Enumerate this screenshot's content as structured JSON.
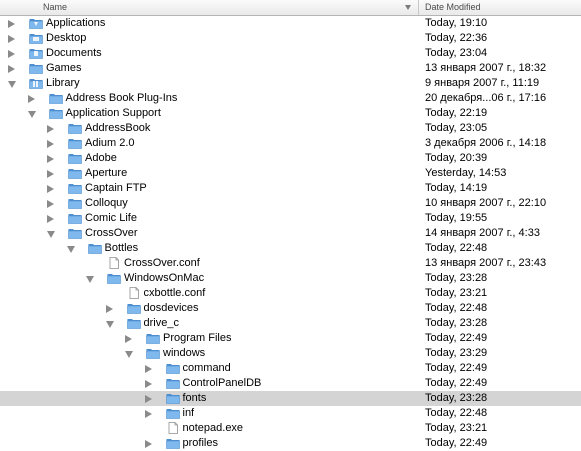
{
  "header": {
    "name_label": "Name",
    "date_label": "Date Modified"
  },
  "rows": [
    {
      "name": "Applications",
      "date": "Today, 19:10",
      "depth": 0,
      "expanded": false,
      "kind": "apps-folder"
    },
    {
      "name": "Desktop",
      "date": "Today, 22:36",
      "depth": 0,
      "expanded": false,
      "kind": "desktop-folder"
    },
    {
      "name": "Documents",
      "date": "Today, 23:04",
      "depth": 0,
      "expanded": false,
      "kind": "documents-folder"
    },
    {
      "name": "Games",
      "date": "13 января 2007 г., 18:32",
      "depth": 0,
      "expanded": false,
      "kind": "folder"
    },
    {
      "name": "Library",
      "date": "9 января 2007 г., 11:19",
      "depth": 0,
      "expanded": true,
      "kind": "library-folder"
    },
    {
      "name": "Address Book Plug-Ins",
      "date": "20 декабря...06 г., 17:16",
      "depth": 1,
      "expanded": false,
      "kind": "folder"
    },
    {
      "name": "Application Support",
      "date": "Today, 22:19",
      "depth": 1,
      "expanded": true,
      "kind": "folder"
    },
    {
      "name": "AddressBook",
      "date": "Today, 23:05",
      "depth": 2,
      "expanded": false,
      "kind": "folder"
    },
    {
      "name": "Adium 2.0",
      "date": "3 декабря 2006 г., 14:18",
      "depth": 2,
      "expanded": false,
      "kind": "folder"
    },
    {
      "name": "Adobe",
      "date": "Today, 20:39",
      "depth": 2,
      "expanded": false,
      "kind": "folder"
    },
    {
      "name": "Aperture",
      "date": "Yesterday, 14:53",
      "depth": 2,
      "expanded": false,
      "kind": "folder"
    },
    {
      "name": "Captain FTP",
      "date": "Today, 14:19",
      "depth": 2,
      "expanded": false,
      "kind": "folder"
    },
    {
      "name": "Colloquy",
      "date": "10 января 2007 г., 22:10",
      "depth": 2,
      "expanded": false,
      "kind": "folder"
    },
    {
      "name": "Comic Life",
      "date": "Today, 19:55",
      "depth": 2,
      "expanded": false,
      "kind": "folder"
    },
    {
      "name": "CrossOver",
      "date": "14 января 2007 г., 4:33",
      "depth": 2,
      "expanded": true,
      "kind": "folder"
    },
    {
      "name": "Bottles",
      "date": "Today, 22:48",
      "depth": 3,
      "expanded": true,
      "kind": "folder"
    },
    {
      "name": "CrossOver.conf",
      "date": "13 января 2007 г., 23:43",
      "depth": 4,
      "expanded": null,
      "kind": "file"
    },
    {
      "name": "WindowsOnMac",
      "date": "Today, 23:28",
      "depth": 4,
      "expanded": true,
      "kind": "folder"
    },
    {
      "name": "cxbottle.conf",
      "date": "Today, 23:21",
      "depth": 5,
      "expanded": null,
      "kind": "file"
    },
    {
      "name": "dosdevices",
      "date": "Today, 22:48",
      "depth": 5,
      "expanded": false,
      "kind": "folder"
    },
    {
      "name": "drive_c",
      "date": "Today, 23:28",
      "depth": 5,
      "expanded": true,
      "kind": "folder"
    },
    {
      "name": "Program Files",
      "date": "Today, 22:49",
      "depth": 6,
      "expanded": false,
      "kind": "folder"
    },
    {
      "name": "windows",
      "date": "Today, 23:29",
      "depth": 6,
      "expanded": true,
      "kind": "folder"
    },
    {
      "name": "command",
      "date": "Today, 22:49",
      "depth": 7,
      "expanded": false,
      "kind": "folder"
    },
    {
      "name": "ControlPanelDB",
      "date": "Today, 22:49",
      "depth": 7,
      "expanded": false,
      "kind": "folder"
    },
    {
      "name": "fonts",
      "date": "Today, 23:28",
      "depth": 7,
      "expanded": false,
      "kind": "folder",
      "selected": true
    },
    {
      "name": "inf",
      "date": "Today, 22:48",
      "depth": 7,
      "expanded": false,
      "kind": "folder"
    },
    {
      "name": "notepad.exe",
      "date": "Today, 23:21",
      "depth": 7,
      "expanded": null,
      "kind": "file"
    },
    {
      "name": "profiles",
      "date": "Today, 22:49",
      "depth": 7,
      "expanded": false,
      "kind": "folder"
    }
  ],
  "colors": {
    "folder_fill": "#7fb8ec",
    "folder_dark": "#4f8fd0",
    "selection": "#d4d4d4",
    "triangle": "#8a8a8a"
  }
}
